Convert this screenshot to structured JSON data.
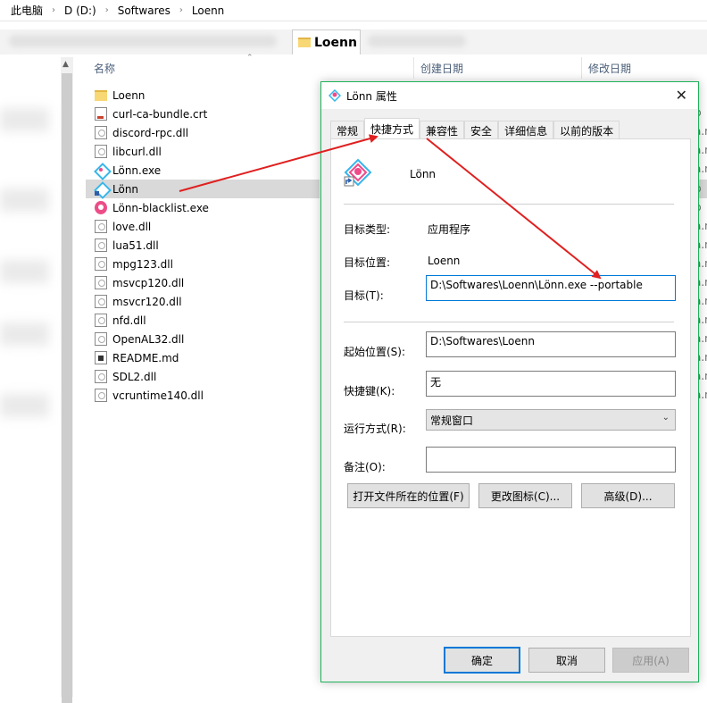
{
  "breadcrumb": [
    "此电脑",
    "D (D:)",
    "Softwares",
    "Loenn"
  ],
  "active_tab": "Loenn",
  "columns": {
    "name": "名称",
    "created": "创建日期",
    "modified": "修改日期"
  },
  "files": [
    {
      "name": "Loenn",
      "icon": "folder-icon"
    },
    {
      "name": "curl-ca-bundle.crt",
      "icon": "certificate-icon"
    },
    {
      "name": "discord-rpc.dll",
      "icon": "dll-icon"
    },
    {
      "name": "libcurl.dll",
      "icon": "dll-icon"
    },
    {
      "name": "Lönn.exe",
      "icon": "lonn-app-icon"
    },
    {
      "name": "Lönn",
      "icon": "shortcut-icon",
      "selected": true
    },
    {
      "name": "Lönn-blacklist.exe",
      "icon": "blacklist-app-icon"
    },
    {
      "name": "love.dll",
      "icon": "dll-icon"
    },
    {
      "name": "lua51.dll",
      "icon": "dll-icon"
    },
    {
      "name": "mpg123.dll",
      "icon": "dll-icon"
    },
    {
      "name": "msvcp120.dll",
      "icon": "dll-icon"
    },
    {
      "name": "msvcr120.dll",
      "icon": "dll-icon"
    },
    {
      "name": "nfd.dll",
      "icon": "dll-icon"
    },
    {
      "name": "OpenAL32.dll",
      "icon": "dll-icon"
    },
    {
      "name": "README.md",
      "icon": "markdown-icon"
    },
    {
      "name": "SDL2.dll",
      "icon": "dll-icon"
    },
    {
      "name": "vcruntime140.dll",
      "icon": "dll-icon"
    }
  ],
  "right_fragments": [
    "",
    "p",
    "a.n",
    "a.n",
    "a.n",
    "p",
    "p",
    "a.n",
    "a.n",
    "a.n",
    "a.n",
    "a.n",
    "a.n",
    "a.n",
    "a.n",
    "a.n",
    "a.n"
  ],
  "dialog": {
    "title": "Lönn 属性",
    "tabs": [
      "常规",
      "快捷方式",
      "兼容性",
      "安全",
      "详细信息",
      "以前的版本"
    ],
    "active_tab": "快捷方式",
    "shortcut_name": "Lönn",
    "target_type_label": "目标类型:",
    "target_type_value": "应用程序",
    "target_location_label": "目标位置:",
    "target_location_value": "Loenn",
    "target_label": "目标(T):",
    "target_value": "D:\\Softwares\\Loenn\\Lönn.exe --portable",
    "start_in_label": "起始位置(S):",
    "start_in_value": "D:\\Softwares\\Loenn",
    "hotkey_label": "快捷键(K):",
    "hotkey_value": "无",
    "run_label": "运行方式(R):",
    "run_value": "常规窗口",
    "comment_label": "备注(O):",
    "comment_value": "",
    "open_location_button": "打开文件所在的位置(F)",
    "change_icon_button": "更改图标(C)...",
    "advanced_button": "高级(D)...",
    "ok_button": "确定",
    "cancel_button": "取消",
    "apply_button": "应用(A)"
  },
  "colors": {
    "accent": "#0078d7",
    "dialog_border": "#1fb25a",
    "arrow": "#e02020",
    "selection": "#d9d9d9"
  }
}
